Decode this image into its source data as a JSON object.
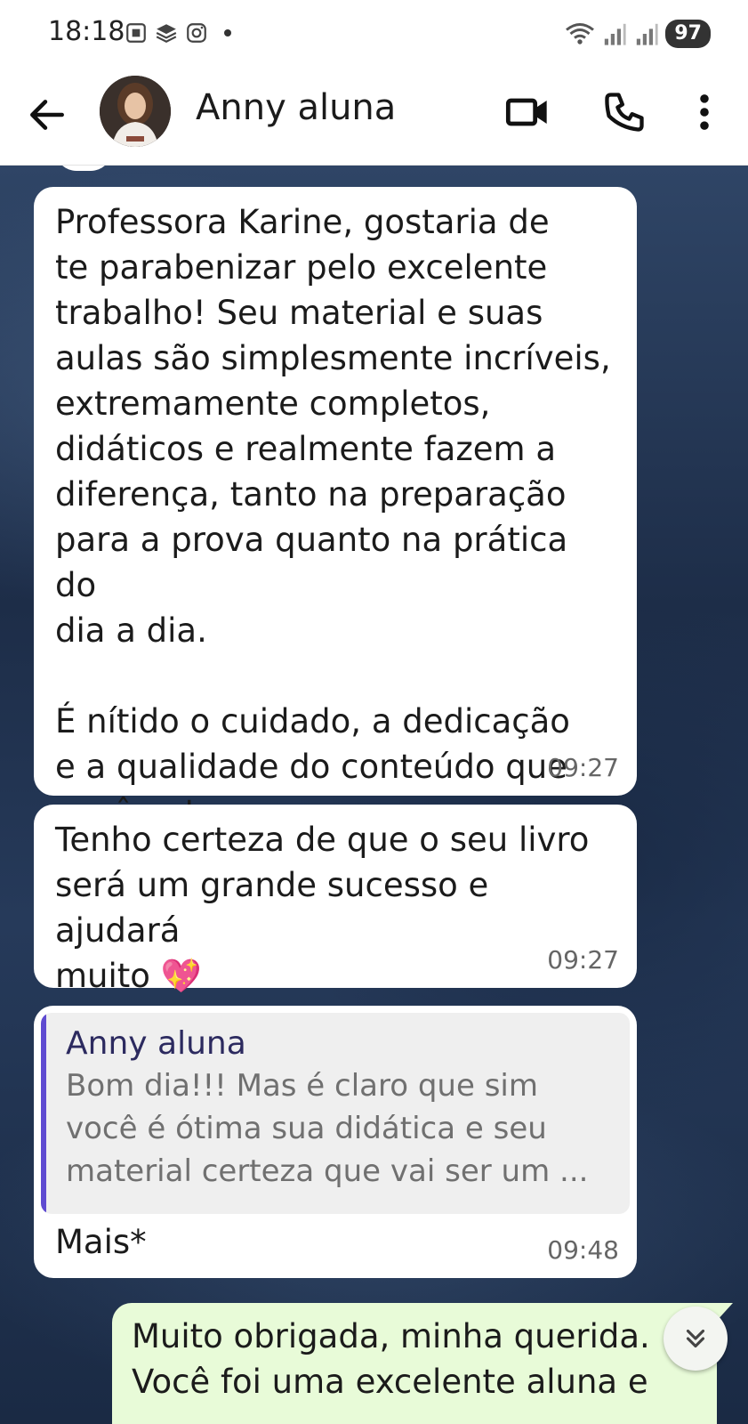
{
  "status_bar": {
    "time": "18:18",
    "battery": "97"
  },
  "header": {
    "contact_name": "Anny aluna",
    "back_icon": "arrow-left-icon",
    "video_icon": "video-camera-icon",
    "call_icon": "phone-icon",
    "menu_icon": "more-vertical-icon"
  },
  "messages": [
    {
      "direction": "incoming",
      "text": "Professora Karine, gostaria de\nte parabenizar pelo excelente\ntrabalho! Seu material e suas\naulas são simplesmente incríveis,\nextremamente completos,\ndidáticos e realmente fazem a\ndiferença, tanto na preparação\npara a prova quanto na prática do\ndia a dia.\n\nÉ nítido o cuidado, a dedicação\ne a qualidade do conteúdo que\nvocê entrega.",
      "time": "09:27"
    },
    {
      "direction": "incoming",
      "text": "Tenho certeza de que o seu livro\nserá um grande sucesso e ajudará\nmuito 💖",
      "time": "09:27"
    },
    {
      "direction": "incoming",
      "quote_author": "Anny aluna",
      "quote_text": "Bom dia!!! Mas é claro que sim\nvocê é ótima sua didática e seu\nmaterial certeza que vai ser um ...",
      "text": "Mais*",
      "time": "09:48"
    },
    {
      "direction": "outgoing",
      "text": "Muito obrigada,  minha querida.\nVocê foi uma excelente aluna e"
    }
  ],
  "colors": {
    "incoming_bubble": "#ffffff",
    "outgoing_bubble": "#e8fbd8",
    "quote_bar": "#5f4bd1"
  }
}
